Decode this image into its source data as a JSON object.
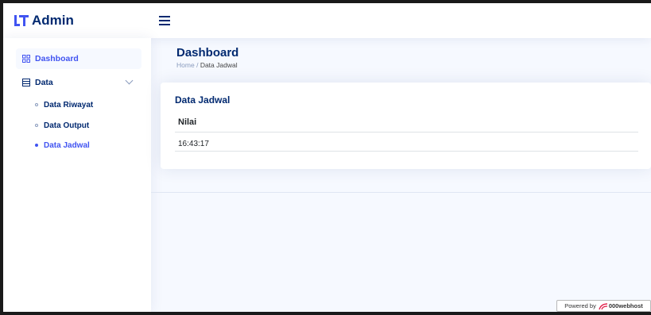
{
  "header": {
    "logo_text": "Admin",
    "menu_icon": "hamburger-icon"
  },
  "sidebar": {
    "items": [
      {
        "label": "Dashboard",
        "icon": "grid-icon",
        "active": true
      },
      {
        "label": "Data",
        "icon": "table-icon",
        "expanded": true,
        "children": [
          {
            "label": "Data Riwayat",
            "active": false
          },
          {
            "label": "Data Output",
            "active": false
          },
          {
            "label": "Data Jadwal",
            "active": true
          }
        ]
      }
    ]
  },
  "main": {
    "page_title": "Dashboard",
    "breadcrumb": {
      "home": "Home",
      "separator": "/",
      "current": "Data Jadwal"
    },
    "card": {
      "title": "Data Jadwal",
      "table": {
        "columns": [
          "Nilai"
        ],
        "rows": [
          [
            "16:43:17"
          ]
        ]
      }
    }
  },
  "footer_badge": {
    "prefix": "Powered by",
    "brand": "000webhost"
  },
  "colors": {
    "accent": "#4154f1",
    "navy": "#012970",
    "background": "#f6f9ff"
  }
}
